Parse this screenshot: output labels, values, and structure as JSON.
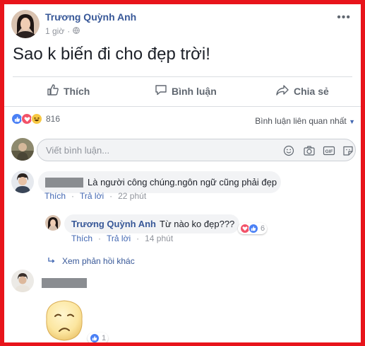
{
  "post": {
    "author": "Trương Quỳnh Anh",
    "time": "1 giờ",
    "text": "Sao k biến đi cho đẹp trời!",
    "actions": {
      "like": "Thích",
      "comment": "Bình luận",
      "share": "Chia sẻ"
    },
    "reaction_count": "816",
    "sort_label": "Bình luận liên quan nhất"
  },
  "composer": {
    "placeholder": "Viết bình luận..."
  },
  "comments": [
    {
      "text": "Là người công chúng.ngôn ngữ cũng phải đẹp",
      "like": "Thích",
      "reply": "Trả lời",
      "time": "22 phút",
      "reply_item": {
        "author": "Trương Quỳnh Anh",
        "text": "Từ nào ko đẹp???",
        "reactions": "6",
        "like": "Thích",
        "reply": "Trả lời",
        "time": "14 phút"
      },
      "more_replies": "Xem phản hồi khác"
    },
    {
      "reactions": "1"
    }
  ],
  "colors": {
    "frame": "#e8141b",
    "link": "#385898",
    "like_blue": "#4a80f5",
    "love_red": "#f25268",
    "haha_yellow": "#f7c843"
  },
  "icons": [
    "globe-icon",
    "more-icon",
    "thumbs-up-icon",
    "comment-icon",
    "share-icon",
    "like-reaction-icon",
    "love-reaction-icon",
    "haha-reaction-icon",
    "caret-down-icon",
    "emoji-icon",
    "camera-icon",
    "gif-icon",
    "sticker-icon",
    "reply-arrow-icon",
    "sticker-face-icon"
  ]
}
